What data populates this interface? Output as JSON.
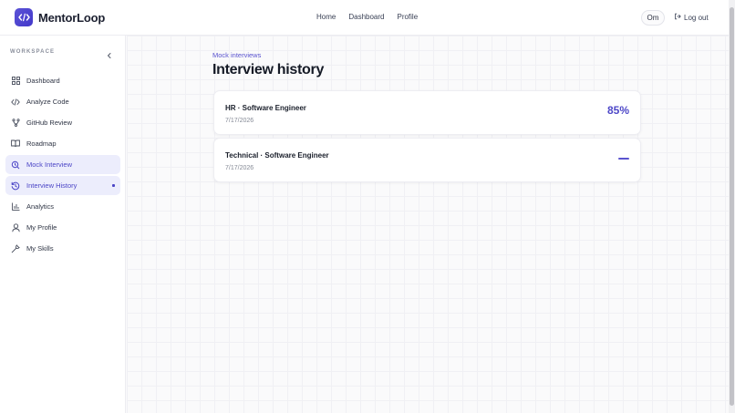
{
  "app": {
    "brand": "MentorLoop",
    "accent": "#4b45c6"
  },
  "header": {
    "nav": [
      "Home",
      "Dashboard",
      "Profile"
    ],
    "user_initials": "Om",
    "logout_label": "Log out"
  },
  "sidebar": {
    "section_label": "WORKSPACE",
    "items": [
      {
        "label": "Dashboard",
        "icon": "grid-icon"
      },
      {
        "label": "Analyze Code",
        "icon": "code-icon"
      },
      {
        "label": "GitHub Review",
        "icon": "git-branch-icon"
      },
      {
        "label": "Roadmap",
        "icon": "book-icon"
      },
      {
        "label": "Mock Interview",
        "icon": "mock-interview-icon",
        "active": true
      },
      {
        "label": "Interview History",
        "icon": "history-icon",
        "current": true
      },
      {
        "label": "Analytics",
        "icon": "bar-chart-icon"
      },
      {
        "label": "My Profile",
        "icon": "user-icon"
      },
      {
        "label": "My Skills",
        "icon": "wrench-icon"
      }
    ]
  },
  "main": {
    "breadcrumb": "Mock interviews",
    "title": "Interview history",
    "interviews": [
      {
        "title": "HR · Software Engineer",
        "date": "7/17/2026",
        "score": "85%"
      },
      {
        "title": "Technical · Software Engineer",
        "date": "7/17/2026",
        "score": null
      }
    ]
  }
}
